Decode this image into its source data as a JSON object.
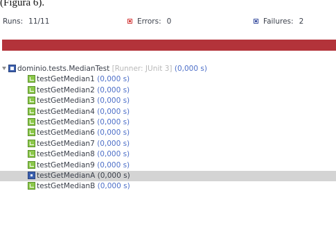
{
  "caption": "(Figura 6).",
  "counters": {
    "runs_label": "Runs:",
    "runs_value": "11/11",
    "errors_label": "Errors:",
    "errors_value": "0",
    "failures_label": "Failures:",
    "failures_value": "2"
  },
  "progress": {
    "status": "failed",
    "fraction": 1.0,
    "color": "#b3333a"
  },
  "tree": {
    "suite": {
      "name": "dominio.tests.MedianTest",
      "runner": "[Runner: JUnit 3]",
      "time": "(0,000 s)",
      "icon": "suite-icon"
    },
    "tests": [
      {
        "name": "testGetMedian1",
        "time": "(0,000 s)",
        "status": "passed",
        "icon": "test-passed-icon"
      },
      {
        "name": "testGetMedian2",
        "time": "(0,000 s)",
        "status": "passed",
        "icon": "test-passed-icon"
      },
      {
        "name": "testGetMedian3",
        "time": "(0,000 s)",
        "status": "passed",
        "icon": "test-passed-icon"
      },
      {
        "name": "testGetMedian4",
        "time": "(0,000 s)",
        "status": "passed",
        "icon": "test-passed-icon"
      },
      {
        "name": "testGetMedian5",
        "time": "(0,000 s)",
        "status": "passed",
        "icon": "test-passed-icon"
      },
      {
        "name": "testGetMedian6",
        "time": "(0,000 s)",
        "status": "passed",
        "icon": "test-passed-icon"
      },
      {
        "name": "testGetMedian7",
        "time": "(0,000 s)",
        "status": "passed",
        "icon": "test-passed-icon"
      },
      {
        "name": "testGetMedian8",
        "time": "(0,000 s)",
        "status": "passed",
        "icon": "test-passed-icon"
      },
      {
        "name": "testGetMedian9",
        "time": "(0,000 s)",
        "status": "passed",
        "icon": "test-passed-icon"
      },
      {
        "name": "testGetMedianA",
        "time": "(0,000 s)",
        "status": "failed",
        "icon": "test-failed-icon",
        "selected": true
      },
      {
        "name": "testGetMedianB",
        "time": "(0,000 s)",
        "status": "passed",
        "icon": "test-passed-icon"
      }
    ]
  },
  "colors": {
    "failure_bar": "#b3333a",
    "time_text": "#4d6fc8",
    "runner_text": "#b8b8b8",
    "selected_row": "#d4d4d4"
  }
}
